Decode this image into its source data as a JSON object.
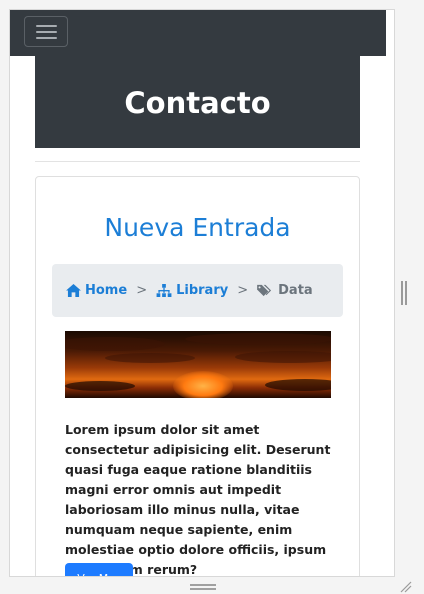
{
  "navbar": {
    "toggler_icon": "hamburger-icon"
  },
  "hero": {
    "title": "Contacto"
  },
  "card": {
    "title": "Nueva Entrada",
    "breadcrumb": {
      "items": [
        {
          "label": "Home",
          "icon": "home-icon"
        },
        {
          "label": "Library",
          "icon": "sitemap-icon"
        },
        {
          "label": "Data",
          "icon": "tags-icon"
        }
      ],
      "separator": ">"
    },
    "image": "sunset-image",
    "text": "Lorem ipsum dolor sit amet consectetur adipisicing elit. Deserunt quasi fuga eaque ratione blanditiis magni error omnis aut impedit laboriosam illo minus nulla, vitae numquam neque sapiente, enim molestiae optio dolore officiis, ipsum quibusdam rerum?",
    "button_label": "Ver Mas"
  },
  "colors": {
    "navbar": "#343a40",
    "link": "#1c7ed6",
    "button": "#1d7bff",
    "breadcrumb_bg": "#e9ecef"
  }
}
